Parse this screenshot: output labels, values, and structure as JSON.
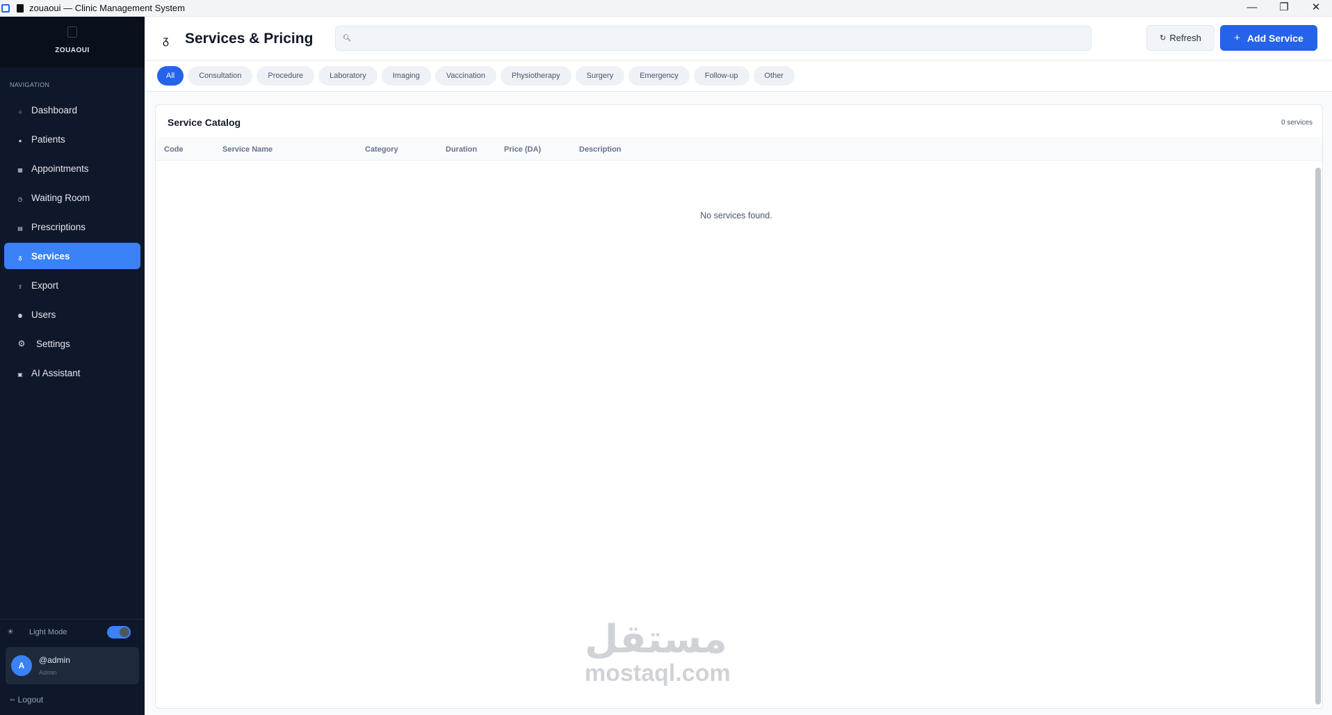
{
  "titlebar": {
    "title": "zouaoui  —  Clinic Management System",
    "minimize": "—",
    "maximize": "❐",
    "close": "✕"
  },
  "sidebar": {
    "brand": "ZOUAOUI",
    "nav_label": "NAVIGATION",
    "items": [
      {
        "label": "Dashboard",
        "icon": "home-icon",
        "glyph": "⌂"
      },
      {
        "label": "Patients",
        "icon": "person-icon",
        "glyph": "●"
      },
      {
        "label": "Appointments",
        "icon": "calendar-icon",
        "glyph": "▦"
      },
      {
        "label": "Waiting Room",
        "icon": "clock-icon",
        "glyph": "◷"
      },
      {
        "label": "Prescriptions",
        "icon": "document-icon",
        "glyph": "▤"
      },
      {
        "label": "Services",
        "icon": "stethoscope-icon",
        "glyph": "ᵹ"
      },
      {
        "label": "Export",
        "icon": "export-icon",
        "glyph": "⇪"
      },
      {
        "label": "Users",
        "icon": "users-icon",
        "glyph": "⚉"
      },
      {
        "label": "Settings",
        "icon": "gear-icon",
        "glyph": "⚙"
      },
      {
        "label": "AI Assistant",
        "icon": "robot-icon",
        "glyph": "▣"
      }
    ],
    "active_item": "Services",
    "theme_label": "Light Mode",
    "theme_toggle_on": true,
    "user": {
      "initial": "A",
      "name": "@admin",
      "role": "Admin"
    },
    "logout": "Logout"
  },
  "header": {
    "title": "Services & Pricing",
    "search_placeholder": "",
    "refresh_label": "Refresh",
    "add_label": "Add Service"
  },
  "filters": [
    "All",
    "Consultation",
    "Procedure",
    "Laboratory",
    "Imaging",
    "Vaccination",
    "Physiotherapy",
    "Surgery",
    "Emergency",
    "Follow-up",
    "Other"
  ],
  "active_filter": "All",
  "catalog": {
    "title": "Service Catalog",
    "count": "0 services",
    "columns": {
      "code": "Code",
      "name": "Service Name",
      "category": "Category",
      "duration": "Duration",
      "price": "Price (DA)",
      "description": "Description"
    },
    "rows": [],
    "empty_message": "No services found."
  },
  "watermark": {
    "arabic": "مستقل",
    "latin": "mostaql.com"
  },
  "colors": {
    "accent": "#2563eb",
    "sidebar_bg": "#0f172a",
    "active_nav": "#3b82f6"
  }
}
